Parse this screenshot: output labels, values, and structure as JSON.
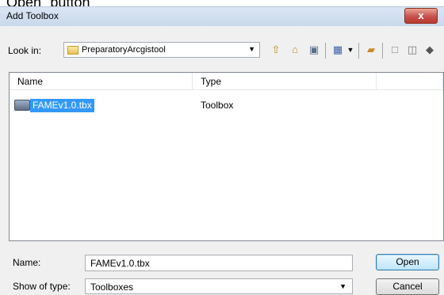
{
  "caption": "Open\" button",
  "window": {
    "title": "Add Toolbox",
    "close_glyph": "x"
  },
  "lookin": {
    "label": "Look in:",
    "value": "PreparatoryArcgistool"
  },
  "toolbar": {
    "icons": [
      "up-folder-icon",
      "home-icon",
      "catalog-icon",
      "view-menu-icon",
      "new-folder-icon",
      "connect-icon",
      "disconnect-icon",
      "options-icon"
    ]
  },
  "list": {
    "columns": [
      "Name",
      "Type"
    ],
    "rows": [
      {
        "name": "FAMEv1.0.tbx",
        "type": "Toolbox"
      }
    ]
  },
  "name_field": {
    "label": "Name:",
    "value": "FAMEv1.0.tbx"
  },
  "type_field": {
    "label": "Show of type:",
    "value": "Toolboxes"
  },
  "buttons": {
    "open": "Open",
    "cancel": "Cancel"
  }
}
